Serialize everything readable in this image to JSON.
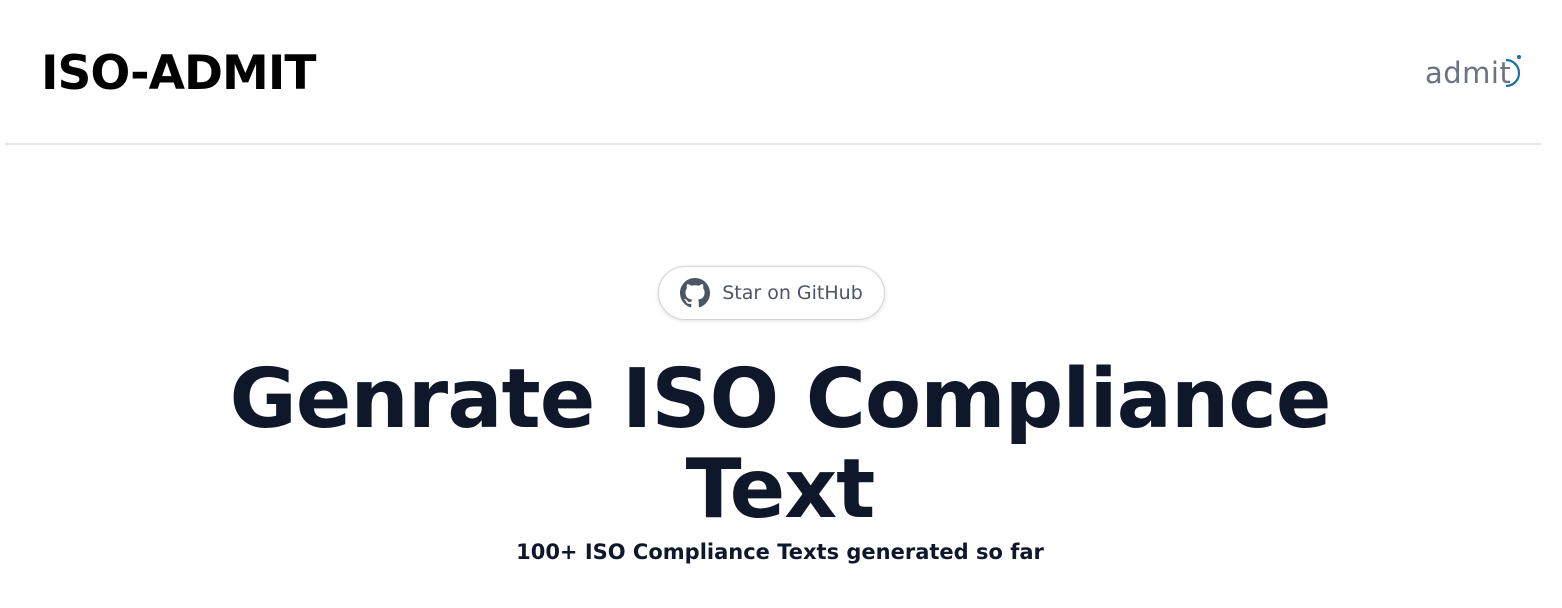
{
  "header": {
    "title": "ISO-ADMIT",
    "logo": {
      "text": "admit",
      "icon": "admit-logo-icon",
      "colors": {
        "text": "#6b7280",
        "accent": "#1e6fa0"
      }
    }
  },
  "hero": {
    "github_button": {
      "icon": "github-icon",
      "label": "Star on GitHub"
    },
    "title": "Genrate ISO Compliance Text",
    "subtitle": "100+ ISO Compliance Texts generated so far"
  },
  "colors": {
    "title": "#0f172a",
    "brand": "#000000",
    "divider": "#e5e7eb",
    "button_border": "#d1d5db",
    "button_text": "#4b5563"
  }
}
